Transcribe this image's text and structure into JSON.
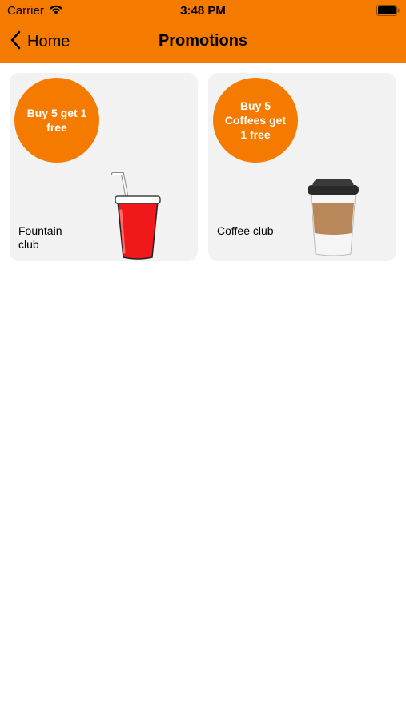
{
  "status_bar": {
    "carrier": "Carrier",
    "time": "3:48 PM"
  },
  "nav": {
    "back_label": "Home",
    "title": "Promotions"
  },
  "colors": {
    "accent": "#f47b00",
    "card_bg": "#f2f2f2"
  },
  "promotions": [
    {
      "badge": "Buy 5 get 1 free",
      "label": "Fountain club",
      "image": "red-soda-cup-icon"
    },
    {
      "badge": "Buy 5 Coffees get 1 free",
      "label": "Coffee club",
      "image": "coffee-cup-icon"
    }
  ]
}
